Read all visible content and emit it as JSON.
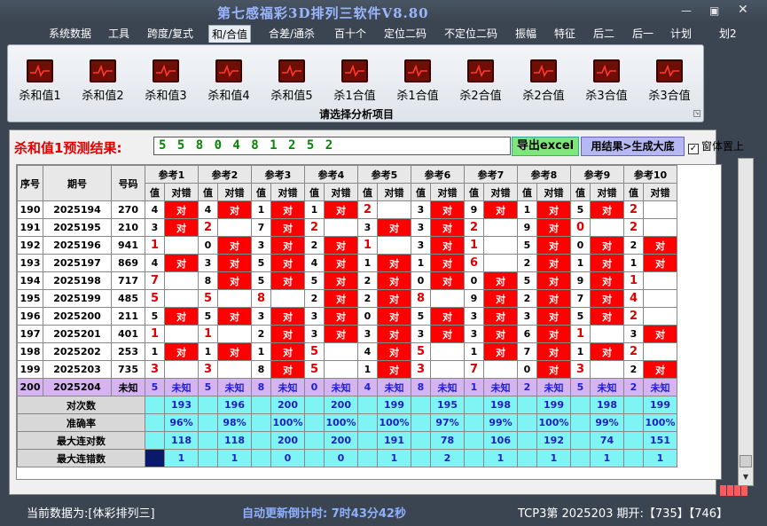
{
  "app": {
    "title": "第七感福彩3D排列三软件V8.80"
  },
  "menu": [
    "系统数据",
    "工具",
    "跨度/复式",
    "和/合值",
    "合差/通杀",
    "百十个",
    "定位二码",
    "不定位二码",
    "振幅",
    "特征",
    "后二",
    "后一",
    "计划",
    "划2"
  ],
  "ribbon": {
    "items": [
      "杀和值1",
      "杀和值2",
      "杀和值3",
      "杀和值4",
      "杀和值5",
      "杀1合值",
      "杀1合值",
      "杀2合值",
      "杀2合值",
      "杀3合值",
      "杀3合值"
    ],
    "caption": "请选择分析项目"
  },
  "predict": {
    "label": "杀和值1预测结果:",
    "value": "5 5 8 0 4 8 1 2 5 2"
  },
  "buttons": {
    "export": "导出excel",
    "generate": "用结果>生成大底",
    "ontop": "窗体置上"
  },
  "table": {
    "headers": {
      "seq": "序号",
      "period": "期号",
      "number": "号码",
      "val": "值",
      "hit": "对错"
    },
    "refs": [
      "参考1",
      "参考2",
      "参考3",
      "参考4",
      "参考5",
      "参考6",
      "参考7",
      "参考8",
      "参考9",
      "参考10"
    ],
    "hit_text": "对",
    "unknown_text": "未知",
    "rows": [
      {
        "seq": "190",
        "period": "2025194",
        "number": "270",
        "vals": [
          "4",
          "4",
          "1",
          "1",
          "2",
          "3",
          "9",
          "1",
          "5",
          "2"
        ]
      },
      {
        "seq": "191",
        "period": "2025195",
        "number": "210",
        "vals": [
          "3",
          "2",
          "7",
          "2",
          "3",
          "3",
          "2",
          "9",
          "0",
          "2"
        ]
      },
      {
        "seq": "192",
        "period": "2025196",
        "number": "941",
        "vals": [
          "1",
          "0",
          "3",
          "2",
          "1",
          "3",
          "1",
          "5",
          "0",
          "2"
        ]
      },
      {
        "seq": "193",
        "period": "2025197",
        "number": "869",
        "vals": [
          "4",
          "3",
          "5",
          "4",
          "1",
          "1",
          "6",
          "2",
          "1",
          "1"
        ]
      },
      {
        "seq": "194",
        "period": "2025198",
        "number": "717",
        "vals": [
          "7",
          "8",
          "5",
          "5",
          "2",
          "0",
          "0",
          "5",
          "9",
          "1"
        ]
      },
      {
        "seq": "195",
        "period": "2025199",
        "number": "485",
        "vals": [
          "5",
          "5",
          "8",
          "2",
          "2",
          "8",
          "9",
          "2",
          "7",
          "4"
        ]
      },
      {
        "seq": "196",
        "period": "2025200",
        "number": "211",
        "vals": [
          "5",
          "5",
          "3",
          "3",
          "0",
          "5",
          "3",
          "3",
          "5",
          "2"
        ]
      },
      {
        "seq": "197",
        "period": "2025201",
        "number": "401",
        "vals": [
          "1",
          "1",
          "2",
          "3",
          "3",
          "3",
          "3",
          "6",
          "1",
          "3"
        ]
      },
      {
        "seq": "198",
        "period": "2025202",
        "number": "253",
        "vals": [
          "1",
          "1",
          "1",
          "5",
          "4",
          "5",
          "1",
          "7",
          "1",
          "2"
        ]
      },
      {
        "seq": "199",
        "period": "2025203",
        "number": "735",
        "vals": [
          "3",
          "3",
          "8",
          "5",
          "1",
          "3",
          "7",
          "0",
          "3",
          "2"
        ]
      }
    ],
    "predict_row": {
      "seq": "200",
      "period": "2025204",
      "number": "未知",
      "vals": [
        "5",
        "5",
        "8",
        "0",
        "4",
        "8",
        "1",
        "2",
        "5",
        "2"
      ]
    },
    "stats": [
      {
        "label": "对次数",
        "vals": [
          "193",
          "196",
          "200",
          "200",
          "199",
          "195",
          "198",
          "199",
          "198",
          "199"
        ]
      },
      {
        "label": "准确率",
        "vals": [
          "96%",
          "98%",
          "100%",
          "100%",
          "100%",
          "97%",
          "99%",
          "100%",
          "99%",
          "100%"
        ]
      },
      {
        "label": "最大连对数",
        "vals": [
          "118",
          "118",
          "200",
          "200",
          "191",
          "78",
          "106",
          "192",
          "74",
          "151"
        ]
      },
      {
        "label": "最大连错数",
        "vals": [
          "1",
          "1",
          "0",
          "0",
          "1",
          "2",
          "1",
          "1",
          "1",
          "1"
        ]
      }
    ]
  },
  "status": {
    "source": "当前数据为:[体彩排列三]",
    "countdown": "自动更新倒计时: 7时43分42秒",
    "draw": "TCP3第 2025203 期开:【735】【746】"
  },
  "colors": {
    "hit": "#ff0000",
    "predict": "#d6b4f2",
    "stats": "#7ff4f4",
    "title": "#9ab6ff"
  }
}
